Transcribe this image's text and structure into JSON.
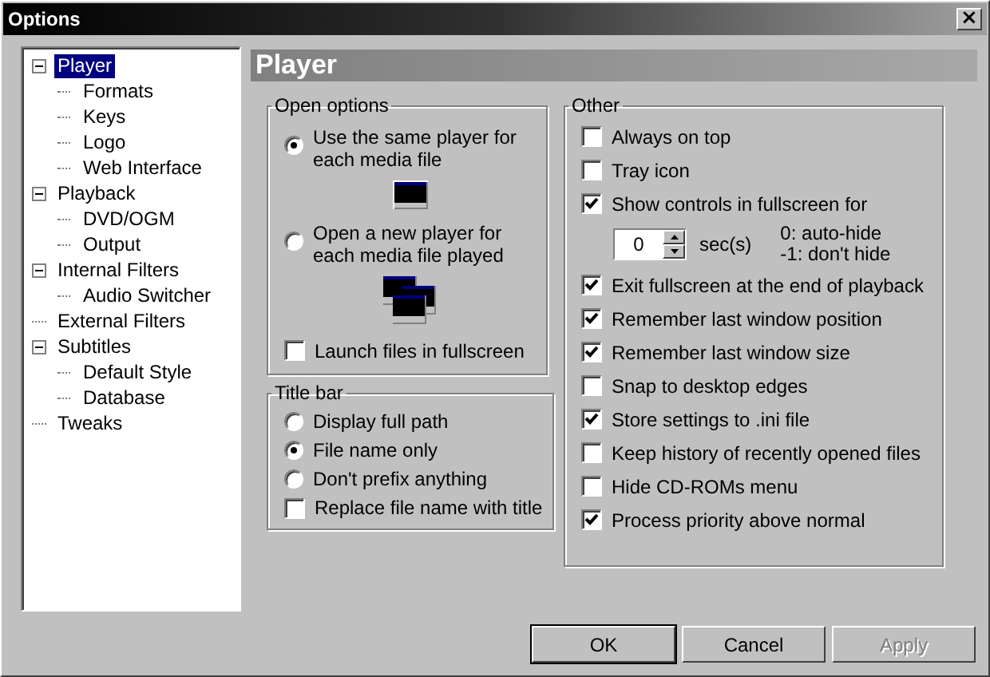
{
  "window": {
    "title": "Options",
    "close": "×"
  },
  "tree": [
    {
      "label": "Player",
      "selected": true,
      "expanded": true,
      "children": [
        {
          "label": "Formats",
          "selected": false
        },
        {
          "label": "Keys",
          "selected": false
        },
        {
          "label": "Logo",
          "selected": false
        },
        {
          "label": "Web Interface",
          "selected": false
        }
      ]
    },
    {
      "label": "Playback",
      "selected": false,
      "expanded": true,
      "children": [
        {
          "label": "DVD/OGM",
          "selected": false
        },
        {
          "label": "Output",
          "selected": false
        }
      ]
    },
    {
      "label": "Internal Filters",
      "selected": false,
      "expanded": true,
      "children": [
        {
          "label": "Audio Switcher",
          "selected": false
        }
      ]
    },
    {
      "label": "External Filters",
      "selected": false
    },
    {
      "label": "Subtitles",
      "selected": false,
      "expanded": true,
      "children": [
        {
          "label": "Default Style",
          "selected": false
        },
        {
          "label": "Database",
          "selected": false
        }
      ]
    },
    {
      "label": "Tweaks",
      "selected": false
    }
  ],
  "page_title": "Player",
  "open_options": {
    "title": "Open options",
    "radios": [
      {
        "label": "Use the same player for each media file",
        "selected": true
      },
      {
        "label": "Open a new player for each media file played",
        "selected": false
      }
    ],
    "launch": {
      "label": "Launch files in fullscreen",
      "checked": false
    }
  },
  "title_bar": {
    "title": "Title bar",
    "items": [
      {
        "kind": "radio",
        "label": "Display full path",
        "selected": false
      },
      {
        "kind": "radio",
        "label": "File name only",
        "selected": true
      },
      {
        "kind": "radio",
        "label": "Don't prefix anything",
        "selected": false
      },
      {
        "kind": "checkbox",
        "label": "Replace file name with title",
        "checked": false
      }
    ]
  },
  "other": {
    "title": "Other",
    "items": [
      {
        "kind": "checkbox",
        "label": "Always on top",
        "checked": false
      },
      {
        "kind": "checkbox",
        "label": "Tray icon",
        "checked": false
      },
      {
        "kind": "checkbox",
        "label": "Show controls in fullscreen for",
        "checked": true
      },
      {
        "kind": "spin",
        "value": "0",
        "unit": "sec(s)",
        "hints": [
          "0: auto-hide",
          "-1: don't hide"
        ]
      },
      {
        "kind": "checkbox",
        "label": "Exit fullscreen at the end of playback",
        "checked": true
      },
      {
        "kind": "checkbox",
        "label": "Remember last window position",
        "checked": true
      },
      {
        "kind": "checkbox",
        "label": "Remember last window size",
        "checked": true
      },
      {
        "kind": "checkbox",
        "label": "Snap to desktop edges",
        "checked": false
      },
      {
        "kind": "checkbox",
        "label": "Store settings to .ini file",
        "checked": true
      },
      {
        "kind": "checkbox",
        "label": "Keep history of recently opened files",
        "checked": false
      },
      {
        "kind": "checkbox",
        "label": "Hide CD-ROMs menu",
        "checked": false
      },
      {
        "kind": "checkbox",
        "label": "Process priority above normal",
        "checked": true
      }
    ]
  },
  "buttons": [
    {
      "label": "OK",
      "default": true,
      "disabled": false
    },
    {
      "label": "Cancel",
      "default": false,
      "disabled": false
    },
    {
      "label": "Apply",
      "default": false,
      "disabled": true
    }
  ]
}
